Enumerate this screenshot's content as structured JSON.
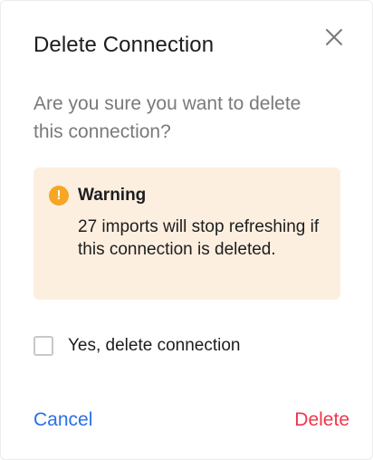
{
  "dialog": {
    "title": "Delete Connection",
    "close_icon": "close-icon",
    "question": "Are you sure you want to delete this connection?"
  },
  "warning": {
    "icon": "exclamation-icon",
    "icon_glyph": "!",
    "title": "Warning",
    "message": "27 imports will stop refreshing if this connection is deleted.",
    "background_color": "#fdefdf",
    "icon_color": "#f5a623"
  },
  "confirm": {
    "checked": false,
    "label": "Yes, delete connection"
  },
  "actions": {
    "cancel_label": "Cancel",
    "delete_label": "Delete",
    "cancel_color": "#2b6fe8",
    "delete_color": "#f0364b"
  }
}
